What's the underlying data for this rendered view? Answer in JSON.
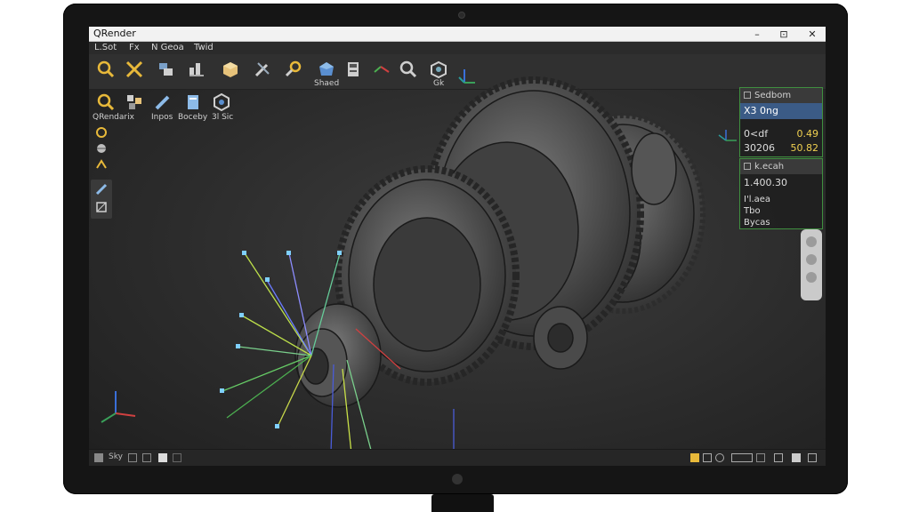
{
  "window": {
    "title": "QRender",
    "minimize": "–",
    "maximize": "⊡",
    "close": "✕"
  },
  "menu": [
    "L.Sot",
    "Fx",
    "N Geoa",
    "Twid"
  ],
  "toolbar": {
    "buttons": [
      {
        "icon": "magnify-icon",
        "label": ""
      },
      {
        "icon": "cross-tools-icon",
        "label": ""
      },
      {
        "icon": "layers-icon",
        "label": ""
      },
      {
        "icon": "align-icon",
        "label": ""
      },
      {
        "icon": "cube-icon",
        "label": ""
      },
      {
        "icon": "wrench-icon",
        "label": ""
      },
      {
        "icon": "link-icon",
        "label": ""
      },
      {
        "icon": "shaded-sphere-icon",
        "label": "Shaed"
      },
      {
        "icon": "save-icon",
        "label": ""
      },
      {
        "icon": "axis-icon",
        "label": ""
      },
      {
        "icon": "zoom-icon",
        "label": ""
      },
      {
        "icon": "render-box-icon",
        "label": "Gk"
      }
    ]
  },
  "secondary_toolbar": {
    "labels": [
      "QRendarix",
      "Inpos",
      "Boceby",
      "3l Sic"
    ]
  },
  "properties": {
    "panel1": {
      "header": "Sedbom",
      "selected": "X3 0ng",
      "rows": [
        {
          "label": "0<df",
          "value": "0.49"
        },
        {
          "label": "30206",
          "value": "50.82"
        }
      ]
    },
    "panel2": {
      "header": "k.ecah",
      "value": "1.400.30",
      "lines": [
        "I'l.aea",
        "Tbo",
        "Bycas"
      ]
    }
  },
  "status": {
    "left": "Sky"
  },
  "colors": {
    "accent": "#3b5b86",
    "panel_border": "#3f8f3f",
    "value": "#f0d050",
    "icon_yellow": "#e8b93a"
  }
}
